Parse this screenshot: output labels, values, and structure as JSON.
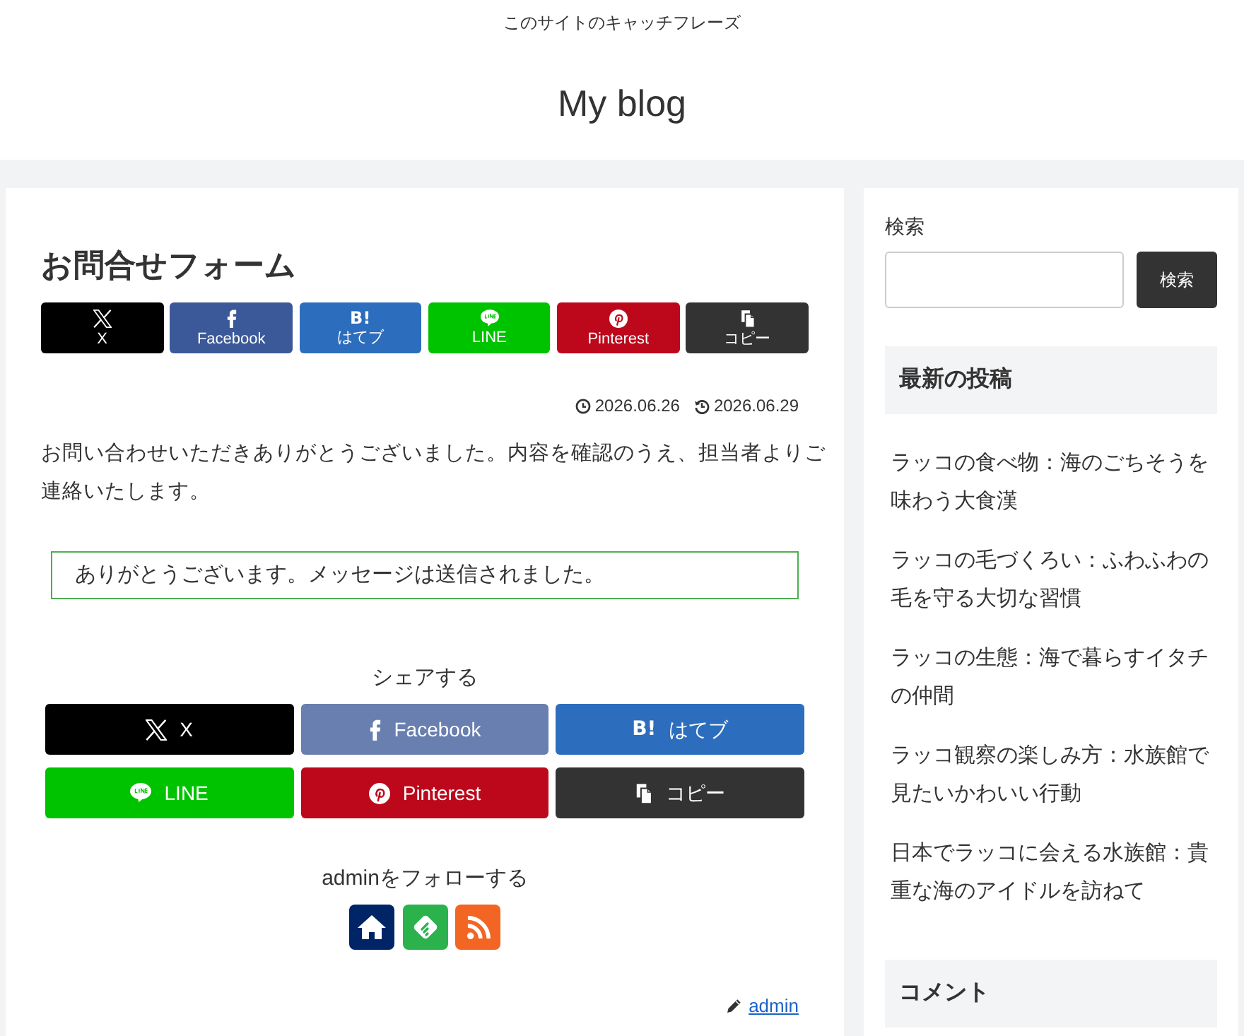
{
  "header": {
    "tagline": "このサイトのキャッチフレーズ",
    "site_title": "My blog"
  },
  "article": {
    "title": "お問合せフォーム",
    "share_top": [
      {
        "kind": "x",
        "label": "X",
        "color": "#000000"
      },
      {
        "kind": "facebook",
        "label": "Facebook",
        "color": "#3b5998"
      },
      {
        "kind": "hatebu",
        "glyph": "B!",
        "label": "はてブ",
        "color": "#2c6ebd"
      },
      {
        "kind": "line",
        "label": "LINE",
        "color": "#00c300"
      },
      {
        "kind": "pinterest",
        "label": "Pinterest",
        "color": "#bd081c"
      },
      {
        "kind": "copy",
        "label": "コピー",
        "color": "#333333"
      }
    ],
    "dates": [
      {
        "kind": "posted",
        "text": "2026.06.26"
      },
      {
        "kind": "updated",
        "text": "2026.06.29"
      }
    ],
    "body": "お問い合わせいただきありがとうございました。内容を確認のうえ、担当者よりご連絡いたします。",
    "notice": "ありがとうございます。メッセージは送信されました。",
    "share_heading": "シェアする",
    "share_bottom": [
      {
        "kind": "x",
        "label": "X",
        "color": "#000000"
      },
      {
        "kind": "facebook",
        "label": "Facebook",
        "color": "#687fb0"
      },
      {
        "kind": "hatebu",
        "glyph": "B!",
        "label": "はてブ",
        "color": "#2c6ebd"
      },
      {
        "kind": "line",
        "label": "LINE",
        "color": "#00c300"
      },
      {
        "kind": "pinterest",
        "label": "Pinterest",
        "color": "#bd081c"
      },
      {
        "kind": "copy",
        "label": "コピー",
        "color": "#333333"
      }
    ],
    "follow_heading": "adminをフォローする",
    "follow_buttons": [
      {
        "kind": "home",
        "color": "#002567"
      },
      {
        "kind": "feedly",
        "color": "#2bb24c"
      },
      {
        "kind": "rss",
        "color": "#f26522"
      }
    ],
    "author": "admin"
  },
  "sidebar": {
    "search": {
      "label": "検索",
      "button": "検索"
    },
    "widgets": [
      {
        "title": "最新の投稿",
        "items": [
          "ラッコの食べ物：海のごちそうを味わう大食漢",
          "ラッコの毛づくろい：ふわふわの毛を守る大切な習慣",
          "ラッコの生態：海で暮らすイタチの仲間",
          "ラッコ観察の楽しみ方：水族館で見たいかわいい行動",
          "日本でラッコに会える水族館：貴重な海のアイドルを訪ねて"
        ]
      },
      {
        "title": "コメント"
      }
    ]
  }
}
